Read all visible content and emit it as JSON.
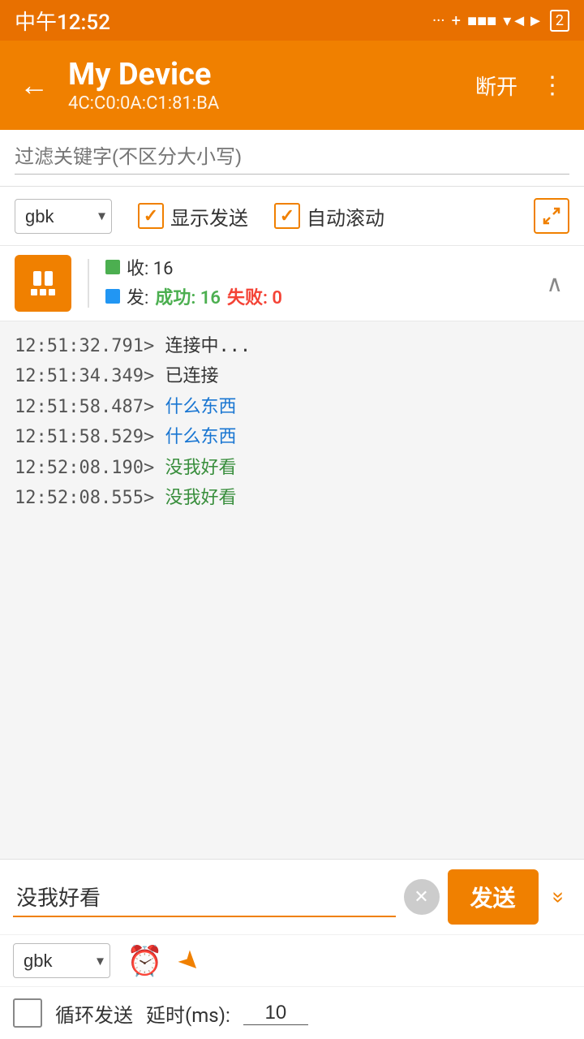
{
  "statusBar": {
    "time": "中午12:52",
    "battery": "2"
  },
  "appBar": {
    "title": "My Device",
    "subtitle": "4C:C0:0A:C1:81:BA",
    "disconnectLabel": "断开",
    "moreLabel": "⋮"
  },
  "filter": {
    "placeholder": "过滤关键字(不区分大小写)"
  },
  "controls": {
    "encoding": "gbk",
    "showSendLabel": "显示发送",
    "autoScrollLabel": "自动滚动"
  },
  "stats": {
    "receivedLabel": "收: 16",
    "sentLabel": "发:",
    "successLabel": "成功: 16",
    "failLabel": "失败: 0"
  },
  "logs": [
    {
      "time": "12:51:32.791>",
      "text": "连接中...",
      "color": "default"
    },
    {
      "time": "12:51:34.349>",
      "text": "已连接",
      "color": "default"
    },
    {
      "time": "12:51:58.487>",
      "text": "什么东西",
      "color": "blue"
    },
    {
      "time": "12:51:58.529>",
      "text": "什么东西",
      "color": "blue"
    },
    {
      "time": "12:52:08.190>",
      "text": "没我好看",
      "color": "green"
    },
    {
      "time": "12:52:08.555>",
      "text": "没我好看",
      "color": "green"
    }
  ],
  "inputArea": {
    "message": "没我好看",
    "sendLabel": "发送",
    "encoding2": "gbk"
  },
  "loopRow": {
    "label": "循环发送",
    "delayLabel": "延时(ms):",
    "delayValue": "10"
  }
}
